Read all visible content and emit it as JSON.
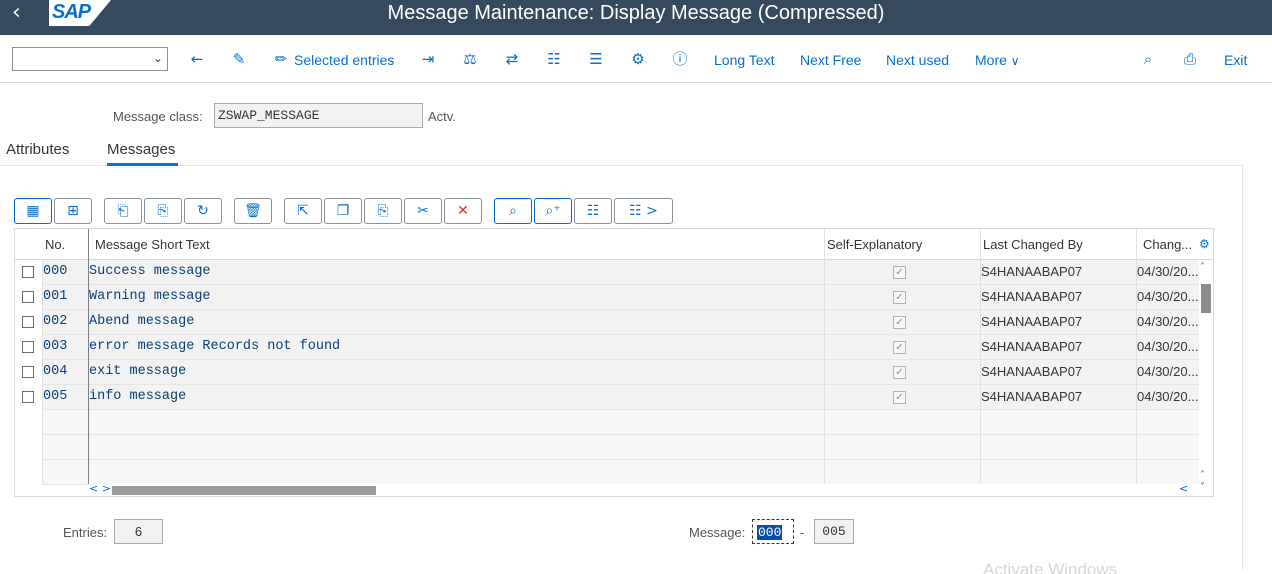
{
  "header": {
    "title": "Message Maintenance: Display Message (Compressed)",
    "logo": "SAP",
    "back_icon": "back-icon"
  },
  "toolbar": {
    "dropdown_value": "",
    "icons": [
      "back-arrow-icon",
      "display-change-icon",
      "edit-icon",
      "other-object-icon",
      "where-used-balance-icon",
      "navigate-icon",
      "hierarchy-icon",
      "align-icon",
      "transport-icon",
      "info-icon",
      "search-icon",
      "print-icon"
    ],
    "selected_entries": "Selected entries",
    "long_text": "Long Text",
    "next_free": "Next Free",
    "next_used": "Next used",
    "more": "More",
    "exit": "Exit"
  },
  "form": {
    "message_class_label": "Message class:",
    "message_class_value": "ZSWAP_MESSAGE",
    "status": "Actv."
  },
  "tabs": [
    {
      "label": "Attributes",
      "active": false
    },
    {
      "label": "Messages",
      "active": true
    }
  ],
  "alv_toolbar": {
    "icons": [
      "details-icon",
      "select-layout-icon",
      "insert-row-icon",
      "append-row-icon",
      "undo-icon",
      "delete-icon",
      "select-block-icon",
      "copy-icon",
      "paste-icon",
      "cut-icon",
      "cancel-icon",
      "find-icon",
      "find-next-icon",
      "sort-icon",
      "more-functions-icon"
    ],
    "more_symbol": ">"
  },
  "table": {
    "columns": [
      "No.",
      "Message Short Text",
      "Self-Explanatory",
      "Last Changed By",
      "Chang..."
    ],
    "rows": [
      {
        "no": "000",
        "text": "Success message",
        "self_explanatory": true,
        "changed_by": "S4HANAABAP07",
        "changed_on": "04/30/20..."
      },
      {
        "no": "001",
        "text": "Warning message",
        "self_explanatory": true,
        "changed_by": "S4HANAABAP07",
        "changed_on": "04/30/20..."
      },
      {
        "no": "002",
        "text": "Abend message",
        "self_explanatory": true,
        "changed_by": "S4HANAABAP07",
        "changed_on": "04/30/20..."
      },
      {
        "no": "003",
        "text": "error message Records not found",
        "self_explanatory": true,
        "changed_by": "S4HANAABAP07",
        "changed_on": "04/30/20..."
      },
      {
        "no": "004",
        "text": "exit message",
        "self_explanatory": true,
        "changed_by": "S4HANAABAP07",
        "changed_on": "04/30/20..."
      },
      {
        "no": "005",
        "text": "info message",
        "self_explanatory": true,
        "changed_by": "S4HANAABAP07",
        "changed_on": "04/30/20..."
      }
    ],
    "scroll_left_symbol": "< >",
    "scroll_right_symbol": "< >"
  },
  "footer": {
    "entries_label": "Entries:",
    "entries_value": "6",
    "message_label": "Message:",
    "message_from": "000",
    "separator": "-",
    "message_to": "005"
  },
  "watermark": "Activate Windows",
  "colors": {
    "title_bar": "#354a5f",
    "accent": "#0a6ed1",
    "row_bg": "#f2f2f2"
  }
}
